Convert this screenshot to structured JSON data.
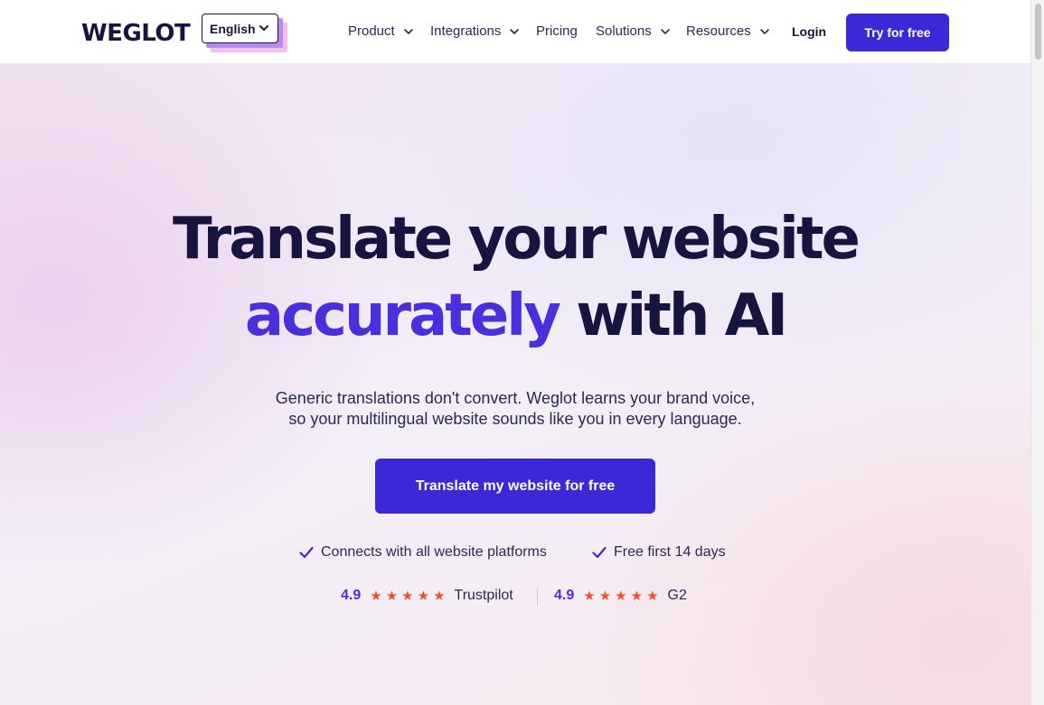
{
  "header": {
    "logo_text": "WEGLOT",
    "language": {
      "selected": "English"
    },
    "nav": [
      {
        "label": "Product",
        "has_dropdown": true
      },
      {
        "label": "Integrations",
        "has_dropdown": true
      },
      {
        "label": "Pricing",
        "has_dropdown": false
      },
      {
        "label": "Solutions",
        "has_dropdown": true
      },
      {
        "label": "Resources",
        "has_dropdown": true
      }
    ],
    "login_label": "Login",
    "try_label": "Try for free"
  },
  "hero": {
    "headline_line1": "Translate your website",
    "headline_accent": "accurately",
    "headline_rest": "with AI",
    "subtitle_line1": "Generic translations don't convert. Weglot learns your brand voice,",
    "subtitle_line2": "so your multilingual website sounds like you in every language.",
    "cta_label": "Translate my website for free",
    "features": [
      {
        "icon": "check-icon",
        "text": "Connects with all website platforms"
      },
      {
        "icon": "check-icon",
        "text": "Free first 14 days"
      }
    ],
    "ratings": [
      {
        "score": "4.9",
        "stars": 5,
        "source": "Trustpilot"
      },
      {
        "score": "4.9",
        "stars": 5,
        "source": "G2"
      }
    ]
  },
  "colors": {
    "primary": "#3b28d6",
    "accent_text": "#4a2fdc",
    "dark_text": "#17153f",
    "star": "#f0522e"
  }
}
